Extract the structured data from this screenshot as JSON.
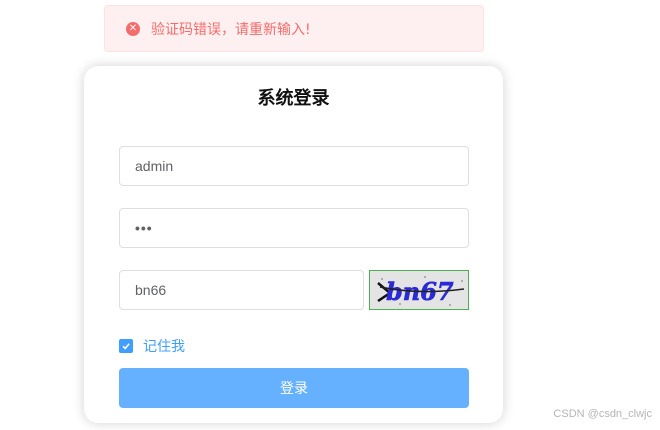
{
  "toast": {
    "icon": "circle-close-icon",
    "message": "验证码错误，请重新输入!",
    "color": "#f56c6c"
  },
  "login": {
    "title": "系统登录",
    "username_value": "admin",
    "password_value": "•••",
    "captcha_input_value": "bn66",
    "captcha_image_text": "bn67",
    "remember_label": "记住我",
    "remember_checked": true,
    "submit_label": "登录"
  },
  "watermark": "CSDN @csdn_clwjc",
  "colors": {
    "primary": "#409eff",
    "button": "#66b1ff",
    "error": "#f56c6c"
  }
}
